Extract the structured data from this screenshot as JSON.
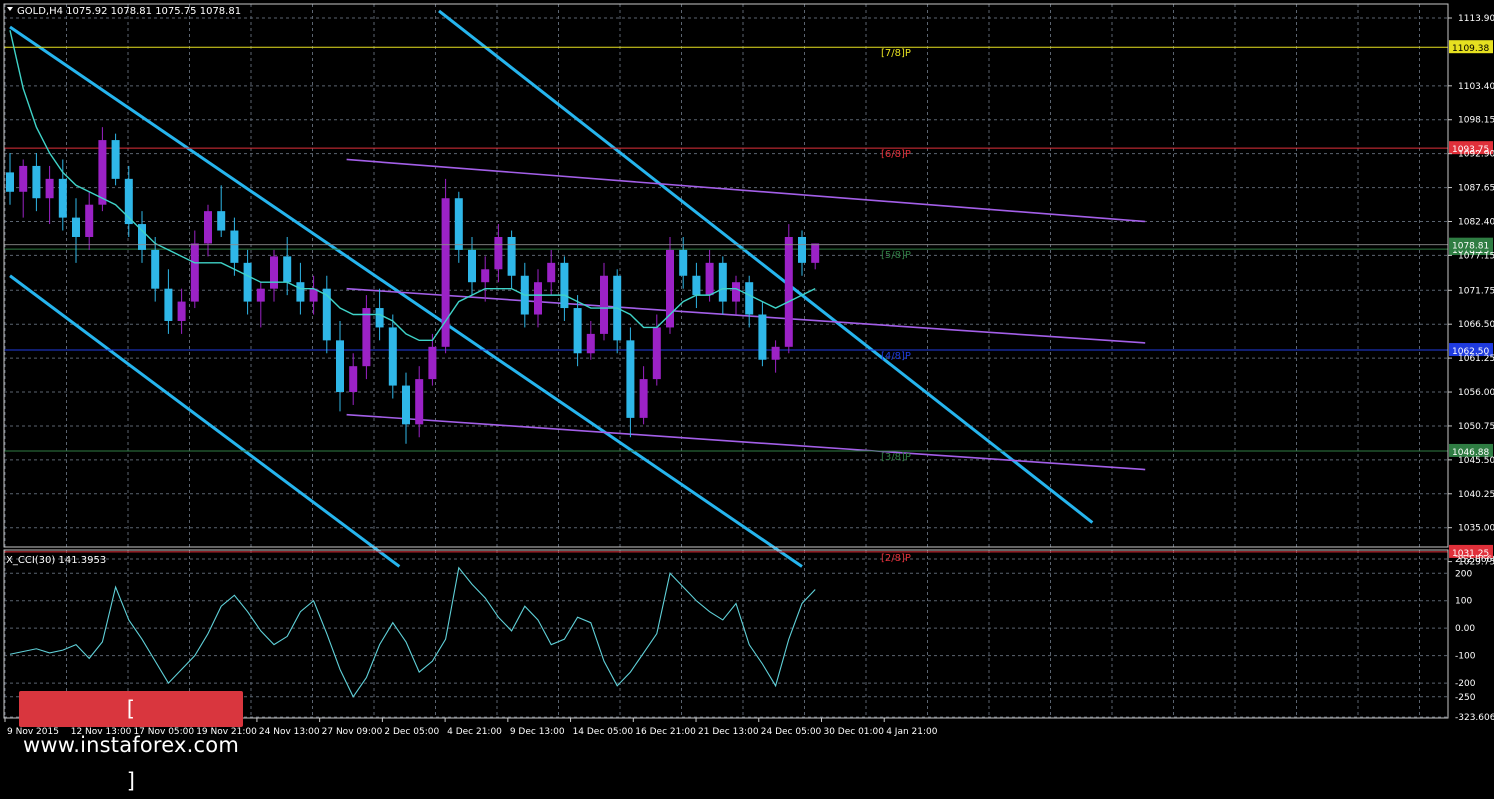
{
  "header": {
    "symbol_info": "GOLD,H4  1075.92 1078.81 1075.75 1078.81",
    "indicator_label": "X_CCI(30) 141.3953"
  },
  "watermark": {
    "text": "[  www.instaforex.com ]"
  },
  "colors": {
    "background": "#000000",
    "grid": "#5b6470",
    "bull_candle": "#9b22c6",
    "bear_candle": "#2fb7e8",
    "moving_average": "#3fd3c8",
    "channel_cyan": "#26b5ee",
    "channel_purple": "#a35fe8",
    "cci_line": "#5fd0d8",
    "murrey_7_8": "#e6e020",
    "murrey_6_8": "#e0303a",
    "murrey_green": "#2f7d43",
    "murrey_blue": "#1f3be0",
    "murrey_2_8": "#e0303a"
  },
  "chart_data": [
    {
      "type": "candlestick",
      "title": "GOLD,H4",
      "ohlc_header": {
        "open": 1075.92,
        "high": 1078.81,
        "low": 1075.75,
        "close": 1078.81
      },
      "ylim": [
        1029.75,
        1113.9
      ],
      "y_ticks": [
        "1113.90",
        "1103.40",
        "1098.15",
        "1092.90",
        "1087.65",
        "1082.40",
        "1077.15",
        "1071.75",
        "1066.50",
        "1061.25",
        "1056.00",
        "1050.75",
        "1045.50",
        "1040.25",
        "1035.00",
        "1029.75"
      ],
      "x_ticks": [
        "9 Nov 2015",
        "12 Nov 13:00",
        "17 Nov 05:00",
        "19 Nov 21:00",
        "24 Nov 13:00",
        "27 Nov 09:00",
        "2 Dec 05:00",
        "4 Dec 21:00",
        "9 Dec 13:00",
        "14 Dec 05:00",
        "16 Dec 21:00",
        "21 Dec 13:00",
        "24 Dec 05:00",
        "30 Dec 01:00",
        "4 Jan 21:00"
      ],
      "price_markers": [
        {
          "level": "7/8",
          "label": "[7/8]P",
          "value": 1109.38,
          "value_label": "1109.38",
          "color": "#e6e020"
        },
        {
          "level": "6/8",
          "label": "[6/8]P",
          "value": 1093.75,
          "value_label": "1093.75",
          "color": "#e0303a"
        },
        {
          "level": "5/8",
          "label": "[5/8]P",
          "value": 1078.13,
          "value_label": "1078.13",
          "color": "#2f7d43"
        },
        {
          "level": "4/8",
          "label": "[4/8]P",
          "value": 1062.5,
          "value_label": "1062.50",
          "color": "#1f3be0"
        },
        {
          "level": "3/8",
          "label": "[3/8]P",
          "value": 1046.88,
          "value_label": "1046.88",
          "color": "#2f7d43"
        },
        {
          "level": "2/8",
          "label": "[2/8]P",
          "value": 1031.25,
          "value_label": "1031.25",
          "color": "#e0303a"
        }
      ],
      "current_price_marker": {
        "value": 1078.81,
        "value_label": "1078.81"
      },
      "candles": [
        {
          "o": 1090,
          "h": 1093,
          "l": 1085,
          "c": 1087
        },
        {
          "o": 1087,
          "h": 1092,
          "l": 1083,
          "c": 1091
        },
        {
          "o": 1091,
          "h": 1093,
          "l": 1084,
          "c": 1086
        },
        {
          "o": 1086,
          "h": 1091,
          "l": 1082,
          "c": 1089
        },
        {
          "o": 1089,
          "h": 1092,
          "l": 1081,
          "c": 1083
        },
        {
          "o": 1083,
          "h": 1086,
          "l": 1076,
          "c": 1080
        },
        {
          "o": 1080,
          "h": 1087,
          "l": 1078,
          "c": 1085
        },
        {
          "o": 1085,
          "h": 1097,
          "l": 1084,
          "c": 1095
        },
        {
          "o": 1095,
          "h": 1096,
          "l": 1088,
          "c": 1089
        },
        {
          "o": 1089,
          "h": 1091,
          "l": 1080,
          "c": 1082
        },
        {
          "o": 1082,
          "h": 1084,
          "l": 1076,
          "c": 1078
        },
        {
          "o": 1078,
          "h": 1080,
          "l": 1070,
          "c": 1072
        },
        {
          "o": 1072,
          "h": 1075,
          "l": 1065,
          "c": 1067
        },
        {
          "o": 1067,
          "h": 1072,
          "l": 1065,
          "c": 1070
        },
        {
          "o": 1070,
          "h": 1081,
          "l": 1069,
          "c": 1079
        },
        {
          "o": 1079,
          "h": 1085,
          "l": 1077,
          "c": 1084
        },
        {
          "o": 1084,
          "h": 1088,
          "l": 1080,
          "c": 1081
        },
        {
          "o": 1081,
          "h": 1083,
          "l": 1074,
          "c": 1076
        },
        {
          "o": 1076,
          "h": 1078,
          "l": 1068,
          "c": 1070
        },
        {
          "o": 1070,
          "h": 1073,
          "l": 1066,
          "c": 1072
        },
        {
          "o": 1072,
          "h": 1078,
          "l": 1070,
          "c": 1077
        },
        {
          "o": 1077,
          "h": 1080,
          "l": 1071,
          "c": 1073
        },
        {
          "o": 1073,
          "h": 1076,
          "l": 1068,
          "c": 1070
        },
        {
          "o": 1070,
          "h": 1074,
          "l": 1068,
          "c": 1072
        },
        {
          "o": 1072,
          "h": 1074,
          "l": 1062,
          "c": 1064
        },
        {
          "o": 1064,
          "h": 1067,
          "l": 1053,
          "c": 1056
        },
        {
          "o": 1056,
          "h": 1062,
          "l": 1054,
          "c": 1060
        },
        {
          "o": 1060,
          "h": 1071,
          "l": 1058,
          "c": 1069
        },
        {
          "o": 1069,
          "h": 1072,
          "l": 1064,
          "c": 1066
        },
        {
          "o": 1066,
          "h": 1068,
          "l": 1055,
          "c": 1057
        },
        {
          "o": 1057,
          "h": 1059,
          "l": 1048,
          "c": 1051
        },
        {
          "o": 1051,
          "h": 1060,
          "l": 1049,
          "c": 1058
        },
        {
          "o": 1058,
          "h": 1065,
          "l": 1057,
          "c": 1063
        },
        {
          "o": 1063,
          "h": 1089,
          "l": 1062,
          "c": 1086
        },
        {
          "o": 1086,
          "h": 1087,
          "l": 1076,
          "c": 1078
        },
        {
          "o": 1078,
          "h": 1080,
          "l": 1071,
          "c": 1073
        },
        {
          "o": 1073,
          "h": 1077,
          "l": 1070,
          "c": 1075
        },
        {
          "o": 1075,
          "h": 1082,
          "l": 1073,
          "c": 1080
        },
        {
          "o": 1080,
          "h": 1081,
          "l": 1072,
          "c": 1074
        },
        {
          "o": 1074,
          "h": 1076,
          "l": 1066,
          "c": 1068
        },
        {
          "o": 1068,
          "h": 1075,
          "l": 1066,
          "c": 1073
        },
        {
          "o": 1073,
          "h": 1078,
          "l": 1071,
          "c": 1076
        },
        {
          "o": 1076,
          "h": 1077,
          "l": 1067,
          "c": 1069
        },
        {
          "o": 1069,
          "h": 1071,
          "l": 1060,
          "c": 1062
        },
        {
          "o": 1062,
          "h": 1067,
          "l": 1061,
          "c": 1065
        },
        {
          "o": 1065,
          "h": 1076,
          "l": 1064,
          "c": 1074
        },
        {
          "o": 1074,
          "h": 1075,
          "l": 1062,
          "c": 1064
        },
        {
          "o": 1064,
          "h": 1066,
          "l": 1049,
          "c": 1052
        },
        {
          "o": 1052,
          "h": 1060,
          "l": 1051,
          "c": 1058
        },
        {
          "o": 1058,
          "h": 1068,
          "l": 1057,
          "c": 1066
        },
        {
          "o": 1066,
          "h": 1080,
          "l": 1065,
          "c": 1078
        },
        {
          "o": 1078,
          "h": 1080,
          "l": 1072,
          "c": 1074
        },
        {
          "o": 1074,
          "h": 1076,
          "l": 1069,
          "c": 1071
        },
        {
          "o": 1071,
          "h": 1078,
          "l": 1070,
          "c": 1076
        },
        {
          "o": 1076,
          "h": 1077,
          "l": 1068,
          "c": 1070
        },
        {
          "o": 1070,
          "h": 1074,
          "l": 1068,
          "c": 1073
        },
        {
          "o": 1073,
          "h": 1074,
          "l": 1066,
          "c": 1068
        },
        {
          "o": 1068,
          "h": 1070,
          "l": 1060,
          "c": 1061
        },
        {
          "o": 1061,
          "h": 1064,
          "l": 1059,
          "c": 1063
        },
        {
          "o": 1063,
          "h": 1082,
          "l": 1062,
          "c": 1080
        },
        {
          "o": 1080,
          "h": 1081,
          "l": 1074,
          "c": 1076
        },
        {
          "o": 1076,
          "h": 1079,
          "l": 1075,
          "c": 1079
        }
      ],
      "moving_average": [
        1112,
        1103,
        1097,
        1093,
        1090,
        1088,
        1087,
        1086,
        1085,
        1083,
        1081,
        1079,
        1078,
        1077,
        1076,
        1076,
        1076,
        1075,
        1074,
        1073,
        1073,
        1073,
        1072,
        1072,
        1071,
        1069,
        1068,
        1068,
        1068,
        1067,
        1065,
        1064,
        1064,
        1067,
        1070,
        1071,
        1072,
        1072,
        1072,
        1071,
        1071,
        1071,
        1071,
        1070,
        1069,
        1069,
        1069,
        1068,
        1066,
        1066,
        1068,
        1070,
        1071,
        1071,
        1072,
        1072,
        1071,
        1070,
        1069,
        1070,
        1071,
        1072
      ],
      "channels": [
        {
          "name": "cyan-upper",
          "color": "#26b5ee",
          "p1": {
            "bar": 32.5,
            "price": 1115
          },
          "p2": {
            "bar": 82,
            "price": 1035.8
          }
        },
        {
          "name": "cyan-middle",
          "color": "#26b5ee",
          "p1": {
            "bar": 0,
            "price": 1112.5
          },
          "p2": {
            "bar": 60,
            "price": 1029
          }
        },
        {
          "name": "cyan-lower",
          "color": "#26b5ee",
          "p1": {
            "bar": 0,
            "price": 1074
          },
          "p2": {
            "bar": 29.5,
            "price": 1029
          }
        },
        {
          "name": "purple-upper",
          "color": "#a35fe8",
          "p1": {
            "bar": 25.5,
            "price": 1092
          },
          "p2": {
            "bar": 86,
            "price": 1082.4
          }
        },
        {
          "name": "purple-middle",
          "color": "#a35fe8",
          "p1": {
            "bar": 25.5,
            "price": 1072
          },
          "p2": {
            "bar": 86,
            "price": 1063.6
          }
        },
        {
          "name": "purple-lower",
          "color": "#a35fe8",
          "p1": {
            "bar": 25.5,
            "price": 1052.5
          },
          "p2": {
            "bar": 86,
            "price": 1044
          }
        }
      ]
    },
    {
      "type": "line",
      "title": "X_CCI(30) 141.3953",
      "ylim": [
        -323.6065,
        252.0668
      ],
      "y_ticks": [
        "252.0668",
        "200",
        "100",
        "0.00",
        "-100",
        "-200",
        "-250",
        "-323.6065"
      ],
      "series": [
        {
          "name": "X_CCI(30)",
          "values": [
            -95,
            -85,
            -75,
            -90,
            -80,
            -60,
            -110,
            -50,
            150,
            30,
            -40,
            -120,
            -200,
            -150,
            -100,
            -20,
            80,
            120,
            60,
            -10,
            -60,
            -30,
            60,
            100,
            -20,
            -150,
            -250,
            -180,
            -60,
            20,
            -50,
            -160,
            -120,
            -40,
            220,
            160,
            110,
            40,
            -10,
            80,
            30,
            -60,
            -40,
            40,
            20,
            -120,
            -210,
            -160,
            -90,
            -20,
            200,
            150,
            100,
            60,
            30,
            90,
            -60,
            -130,
            -210,
            -40,
            90,
            141
          ]
        }
      ]
    }
  ]
}
